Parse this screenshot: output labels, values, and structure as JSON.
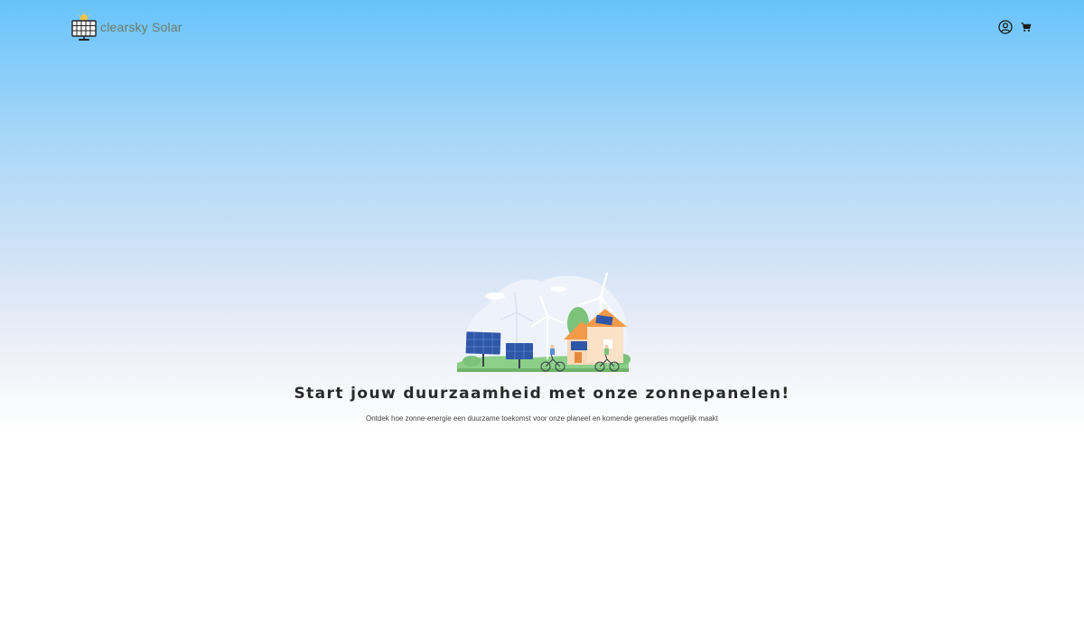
{
  "header": {
    "brand_name": "clearsky Solar",
    "icons": [
      "solar-panel-logo-icon",
      "user-account-icon",
      "shopping-cart-icon"
    ]
  },
  "hero": {
    "title": "Start jouw duurzaamheid met onze zonnepanelen!",
    "subtitle": "Ontdek hoe zonne-energie een duurzame toekomst voor onze planeet en komende generaties mogelijk maakt"
  },
  "colors": {
    "sky_top": "#67c3fb",
    "sky_mid": "#cfe2f6",
    "panel_blue": "#2f57a8",
    "roof_orange": "#f29a47",
    "grass_green": "#7cc27a"
  }
}
